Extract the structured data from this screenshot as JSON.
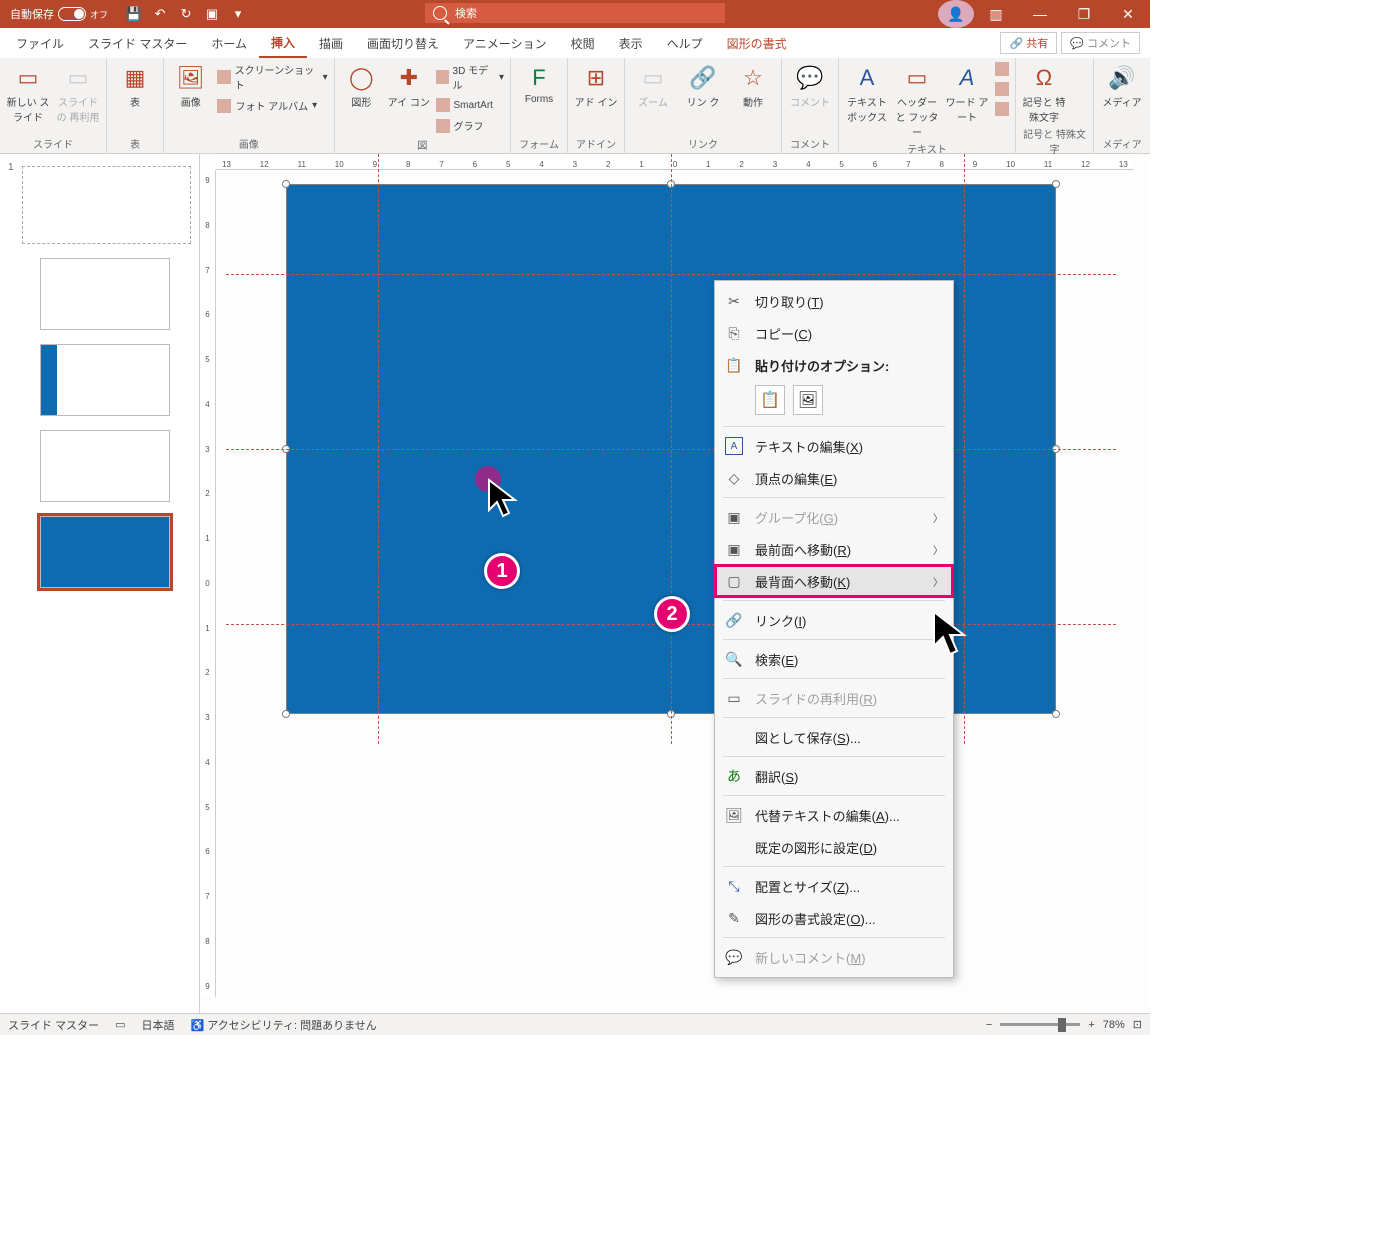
{
  "titlebar": {
    "autosave_label": "自動保存",
    "autosave_state": "オフ",
    "search_placeholder": "検索"
  },
  "win": {
    "minimize": "—",
    "restore": "❐",
    "close": "✕",
    "ribbon_opts": "▥"
  },
  "tabs": {
    "file": "ファイル",
    "slide_master": "スライド マスター",
    "home": "ホーム",
    "insert": "挿入",
    "draw": "描画",
    "transitions": "画面切り替え",
    "animations": "アニメーション",
    "review": "校閲",
    "view": "表示",
    "help": "ヘルプ",
    "shape_format": "図形の書式",
    "share": "共有",
    "comments": "コメント"
  },
  "ribbon": {
    "groups": {
      "slides": {
        "label": "スライド",
        "new_slide": "新しい\nスライド",
        "reuse": "スライドの\n再利用"
      },
      "tables": {
        "label": "表",
        "table": "表"
      },
      "images": {
        "label": "画像",
        "image": "画像",
        "screenshot": "スクリーンショット",
        "album": "フォト アルバム"
      },
      "illust": {
        "label": "図",
        "shapes": "図形",
        "icons": "アイ\nコン",
        "models": "3D モデル",
        "smartart": "SmartArt",
        "chart": "グラフ"
      },
      "forms": {
        "label": "フォーム",
        "forms": "Forms"
      },
      "addins": {
        "label": "アドイン",
        "addin": "アド\nイン"
      },
      "links": {
        "label": "リンク",
        "zoom": "ズーム",
        "link": "リン\nク",
        "action": "動作"
      },
      "comments": {
        "label": "コメント",
        "comment": "コメント"
      },
      "text": {
        "label": "テキスト",
        "textbox": "テキスト\nボックス",
        "hf": "ヘッダーと\nフッター",
        "wordart": "ワード\nアート"
      },
      "symbols": {
        "label": "記号と\n特殊文字",
        "symbol": "記号と\n特殊文字"
      },
      "media": {
        "label": "メディア",
        "media": "メディア"
      }
    }
  },
  "context_menu": {
    "cut": "切り取り(T)",
    "copy": "コピー(C)",
    "paste_label": "貼り付けのオプション:",
    "edit_text": "テキストの編集(X)",
    "edit_points": "頂点の編集(E)",
    "group": "グループ化(G)",
    "bring_front": "最前面へ移動(R)",
    "send_back": "最背面へ移動(K)",
    "link": "リンク(I)",
    "search": "検索(E)",
    "reuse_slide": "スライドの再利用(R)",
    "save_as_pic": "図として保存(S)...",
    "translate": "翻訳(S)",
    "alt_text": "代替テキストの編集(A)...",
    "set_default": "既定の図形に設定(D)",
    "size_pos": "配置とサイズ(Z)...",
    "format_shape": "図形の書式設定(O)...",
    "new_comment": "新しいコメント(M)"
  },
  "statusbar": {
    "mode": "スライド マスター",
    "lang": "日本語",
    "a11y": "アクセシビリティ: 問題ありません",
    "zoom": "78%"
  },
  "callouts": {
    "one": "1",
    "two": "2"
  },
  "ruler": {
    "h": [
      "13",
      "12",
      "11",
      "10",
      "9",
      "8",
      "7",
      "6",
      "5",
      "4",
      "3",
      "2",
      "1",
      "0",
      "1",
      "2",
      "3",
      "4",
      "5",
      "6",
      "7",
      "8",
      "9",
      "10",
      "11",
      "12",
      "13"
    ],
    "v": [
      "9",
      "8",
      "7",
      "6",
      "5",
      "4",
      "3",
      "2",
      "1",
      "0",
      "1",
      "2",
      "3",
      "4",
      "5",
      "6",
      "7",
      "8",
      "9"
    ]
  }
}
